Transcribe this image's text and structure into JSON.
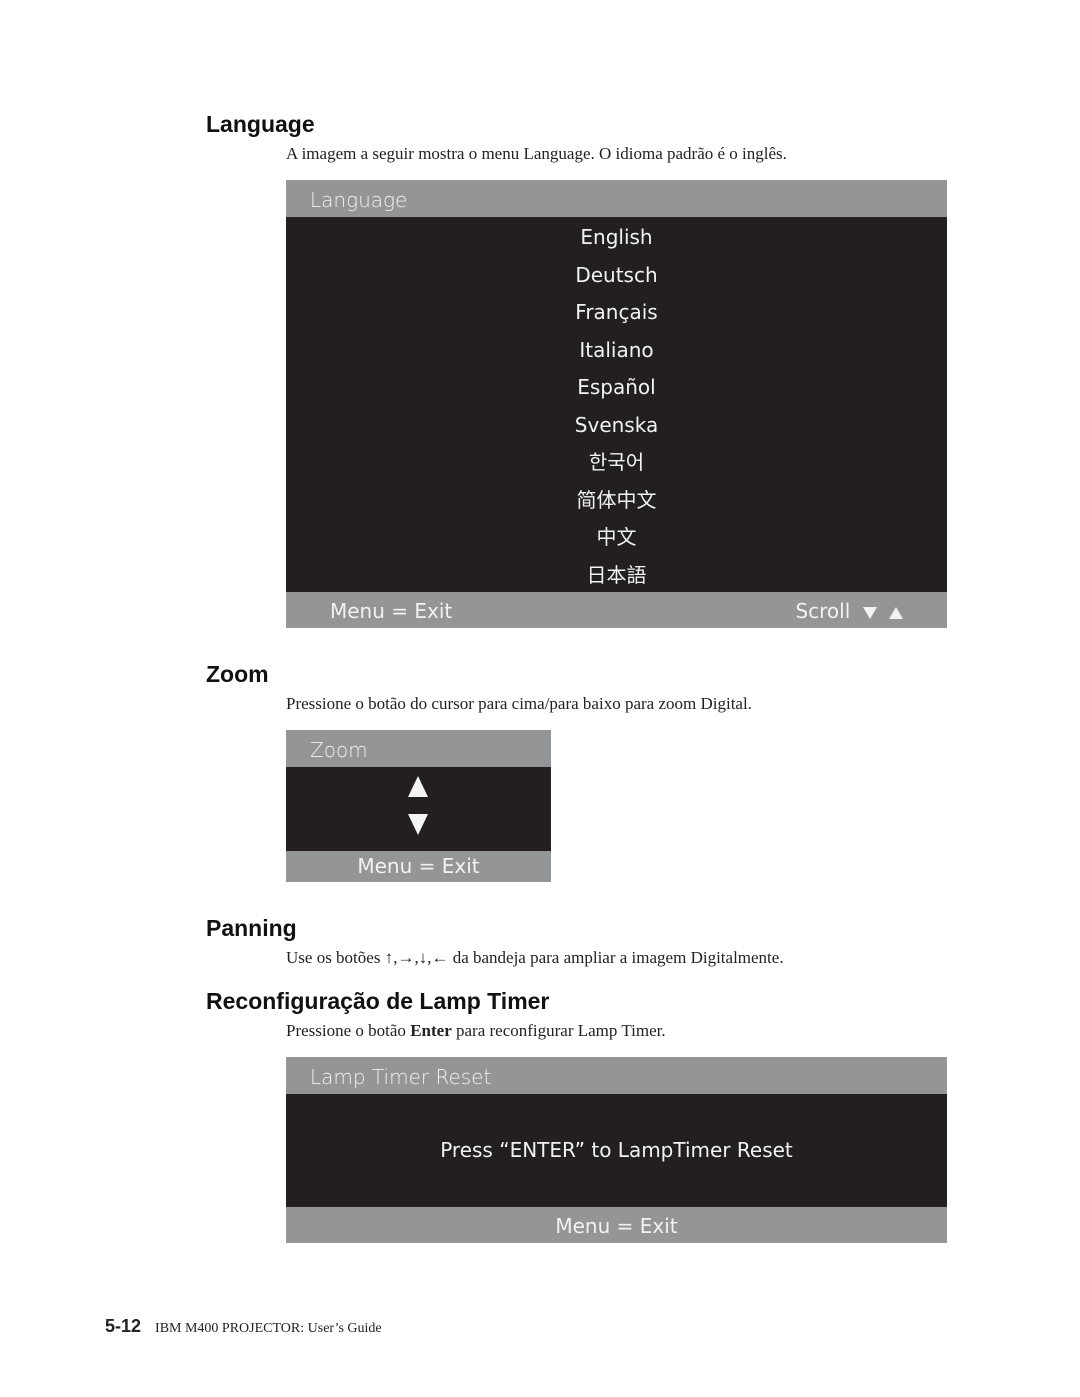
{
  "sections": {
    "language": {
      "heading": "Language",
      "description": "A imagem a seguir mostra o menu Language. O idioma padrão é o inglês.",
      "osd": {
        "title": "Language",
        "items": [
          "English",
          "Deutsch",
          "Français",
          "Italiano",
          "Español",
          "Svenska",
          "한국어",
          "简体中文",
          "中文",
          "日本語"
        ],
        "footer_left": "Menu = Exit",
        "footer_right": "Scroll",
        "scroll_icons": [
          "triangle-down-icon",
          "triangle-up-icon"
        ]
      }
    },
    "zoom": {
      "heading": "Zoom",
      "description": "Pressione o botão do cursor para cima/para baixo para zoom Digital.",
      "osd": {
        "title": "Zoom",
        "icons": [
          "triangle-up-icon",
          "triangle-down-icon"
        ],
        "footer": "Menu = Exit"
      }
    },
    "panning": {
      "heading": "Panning",
      "description": "Use os botões ↑,→,↓,← da bandeja para ampliar a imagem Digitalmente."
    },
    "lamp_timer": {
      "heading": "Reconfiguração de Lamp Timer",
      "description_pre": "Pressione o botão ",
      "description_bold": "Enter",
      "description_post": " para reconfigurar Lamp Timer.",
      "osd": {
        "title": "Lamp Timer Reset",
        "message": "Press “ENTER” to LampTimer Reset",
        "footer": "Menu = Exit"
      }
    }
  },
  "footer": {
    "page_number": "5-12",
    "title": "IBM M400 PROJECTOR: User’s Guide"
  }
}
